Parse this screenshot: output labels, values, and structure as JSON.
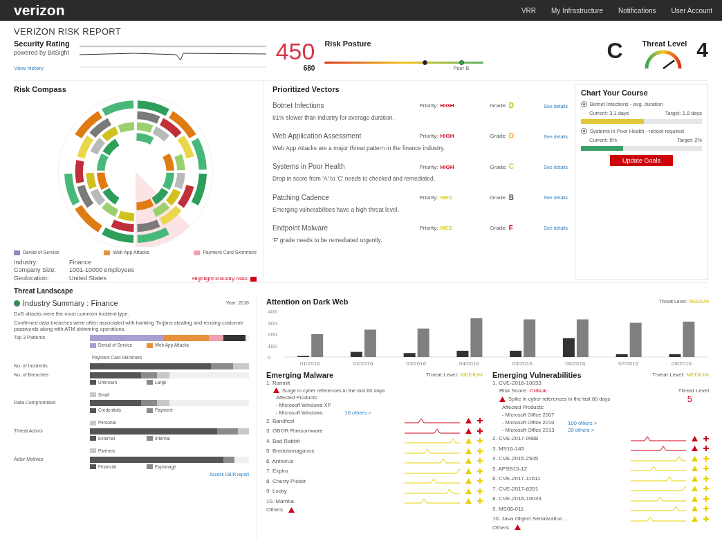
{
  "header": {
    "logo": "verizon",
    "nav": [
      {
        "label": "VRR",
        "selected": false
      },
      {
        "label": "My Infrastructure",
        "selected": false
      },
      {
        "label": "Notifications",
        "selected": false
      },
      {
        "label": "User Account",
        "selected": false
      }
    ]
  },
  "page_title": "VERIZON RISK REPORT",
  "security_rating": {
    "title": "Security Rating",
    "subtitle": "powered by BitSight",
    "link": "View history",
    "score": "450",
    "peer_score": "680"
  },
  "risk_posture": {
    "title": "Risk Posture",
    "level": 0.63,
    "peer_label": "Peer B",
    "grade": "C"
  },
  "threat_level": {
    "title": "Threat Level",
    "value": "4"
  },
  "risk_compass": {
    "title": "Risk Compass",
    "legend": [
      {
        "label": "Denial of Service",
        "color": "#8a86c4"
      },
      {
        "label": "Web App Attacks",
        "color": "#e8913a"
      },
      {
        "label": "Payment Card Skimmers",
        "color": "#f0a0b0"
      }
    ],
    "info": [
      {
        "label": "Industry:",
        "value": "Finance"
      },
      {
        "label": "Company Size:",
        "value": "1001-10000 employees"
      },
      {
        "label": "Geolocation:",
        "value": "United States"
      }
    ],
    "link": "Highlight industry risks"
  },
  "vectors": {
    "title": "Prioritized Vectors",
    "items": [
      {
        "name": "Botnet Infections",
        "priority": {
          "label": "Priority:",
          "value": "HIGH",
          "color": "#d0021b"
        },
        "grade": {
          "label": "Grade:",
          "value": "D",
          "color": "#b7c400"
        },
        "link": "See details",
        "description": "81% slower than industry for average duration."
      },
      {
        "name": "Web Application Assessment",
        "priority": {
          "label": "Priority:",
          "value": "HIGH",
          "color": "#d0021b"
        },
        "grade": {
          "label": "Grade:",
          "value": "D",
          "color": "#f5a623"
        },
        "link": "See details",
        "description": "Web App Attacks are a major threat pattern in the finance industry."
      },
      {
        "name": "Systems in Poor Health",
        "priority": {
          "label": "Priority:",
          "value": "HIGH",
          "color": "#d0021b"
        },
        "grade": {
          "label": "Grade:",
          "value": "C",
          "color": "#c8d44a"
        },
        "link": "See details",
        "description": "Drop in score from 'A' to 'C' needs to checked and remediated."
      },
      {
        "name": "Patching Cadence",
        "priority": {
          "label": "Priority:",
          "value": "MED",
          "color": "#e8d000"
        },
        "grade": {
          "label": "Grade:",
          "value": "B",
          "color": "#555555"
        },
        "link": "See details",
        "description": "Emerging vulnerabilities have a high threat level."
      },
      {
        "name": "Endpoint Malware",
        "priority": {
          "label": "Priority:",
          "value": "MED",
          "color": "#e8d000"
        },
        "grade": {
          "label": "Grade:",
          "value": "F",
          "color": "#d0021b"
        },
        "link": "See details",
        "description": "'F' grade needs to be remediated urgently."
      }
    ]
  },
  "course": {
    "title": "Chart Your Course",
    "goals": [
      {
        "title": "Botnet Infections - avg. duration",
        "current": "Current: 3.1 days",
        "target": "Target: 1.8 days",
        "level": 0.52,
        "color": "#e0c83a"
      },
      {
        "title": "Systems in Poor Health - reboot required",
        "current": "Current: 5%",
        "target": "Target: 2%",
        "level": 0.35,
        "color": "#3aa06a"
      }
    ],
    "button": "Update Goals"
  },
  "threat_landscape": {
    "title": "Threat Landscape"
  },
  "industry_summary": {
    "title": "Industry Summary : Finance",
    "year": "Year: 2016",
    "facts": [
      "DoS attacks were the most common incident type.",
      "Confirmed data breaches were often associated with banking Trojans stealing and reusing customer passwords along with ATM skimming operations."
    ],
    "rows": [
      {
        "label": "Top 3 Patterns",
        "legend": [
          "Denial of Service",
          "Web App Attacks",
          "Payment Card Skimmers"
        ]
      },
      {
        "label": "No. of Incidents",
        "legend": []
      },
      {
        "label": "No. of Breaches",
        "legend": [
          "Unknown",
          "Large",
          "Small"
        ]
      },
      {
        "label": "Data Compromised",
        "legend": [
          "Credentials",
          "Payment",
          "Personal"
        ]
      },
      {
        "label": "Threat Actors",
        "legend": [
          "External",
          "Internal",
          "Partners"
        ]
      },
      {
        "label": "Actor Motives",
        "legend": [
          "Financial",
          "Espionage"
        ]
      }
    ],
    "link": "Access DBIR report"
  },
  "dark_web": {
    "title": "Attention on Dark Web",
    "threat_label": "Threat Level:",
    "threat_value": "MEDIUM",
    "chart_data": {
      "type": "bar",
      "categories": [
        "01/2016",
        "02/2016",
        "03/2016",
        "04/2016",
        "05/2016",
        "06/2016",
        "07/2016",
        "08/2016"
      ],
      "series": [
        {
          "color": "#333333",
          "values": [
            10,
            45,
            35,
            55,
            55,
            165,
            25,
            25
          ]
        },
        {
          "color": "#808080",
          "values": [
            200,
            240,
            250,
            340,
            330,
            330,
            300,
            310
          ]
        }
      ],
      "ylim": [
        0,
        400
      ],
      "yticks": [
        0,
        100,
        200,
        300,
        400
      ]
    }
  },
  "malware": {
    "title": "Emerging Malware",
    "threat_label": "Threat Level:",
    "threat_value": "MEDIUM",
    "top": {
      "name": "1. Ramnit",
      "alert": "Surge in cyber references in the last 60 days",
      "products_title": "Affected Products:",
      "products": [
        "- Microsoft Windows XP",
        "- Microsoft Windows"
      ],
      "links": [
        "10 others >"
      ]
    },
    "items": [
      {
        "name": "2. Bandfest",
        "color": "#d0021b"
      },
      {
        "name": "3. GBOR Ransomware",
        "color": "#d0021b"
      },
      {
        "name": "4. Bad Rabbit",
        "color": "#e8d000"
      },
      {
        "name": "5. Bredolamaganos",
        "color": "#e8d000"
      },
      {
        "name": "6. Antivirus",
        "color": "#e8d000"
      },
      {
        "name": "7. Expiro",
        "color": "#e8d000"
      },
      {
        "name": "8. Cherry Picker",
        "color": "#e8d000"
      },
      {
        "name": "9. Locky",
        "color": "#e8d000"
      },
      {
        "name": "10. Mamba",
        "color": "#e8d000"
      }
    ],
    "others": "Others"
  },
  "vulnerabilities": {
    "title": "Emerging Vulnerabilities",
    "threat_label": "Threat Level:",
    "threat_value": "MEDIUM",
    "top": {
      "name": "1. CVE-2016-10033",
      "risk_label": "Risk Score:",
      "risk_value": "Critical",
      "level_label": "Threat Level",
      "level_value": "5",
      "alert": "Spike in cyber references in the last 60 days",
      "products_title": "Affected Products:",
      "products": [
        "- Microsoft Office 2007",
        "- Microsoft Office 2010",
        "- Microsoft Office 2013"
      ],
      "links": [
        "100 others >",
        "20 others >"
      ]
    },
    "items": [
      {
        "name": "2. CVE-2017-0088",
        "color": "#d0021b"
      },
      {
        "name": "3. MS16-145",
        "color": "#d0021b"
      },
      {
        "name": "4. CVE-2015-2545",
        "color": "#e8d000"
      },
      {
        "name": "5. APSB15-12",
        "color": "#e8d000"
      },
      {
        "name": "6. CVE-2017-11611",
        "color": "#e8d000"
      },
      {
        "name": "7. CVE-2017-8201",
        "color": "#e8d000"
      },
      {
        "name": "8. CVE-2016-10033",
        "color": "#e8d000"
      },
      {
        "name": "9. MS08-011",
        "color": "#e8d000"
      },
      {
        "name": "10. Java Object Serialization ...",
        "color": "#e8d000"
      }
    ],
    "others": "Others"
  }
}
